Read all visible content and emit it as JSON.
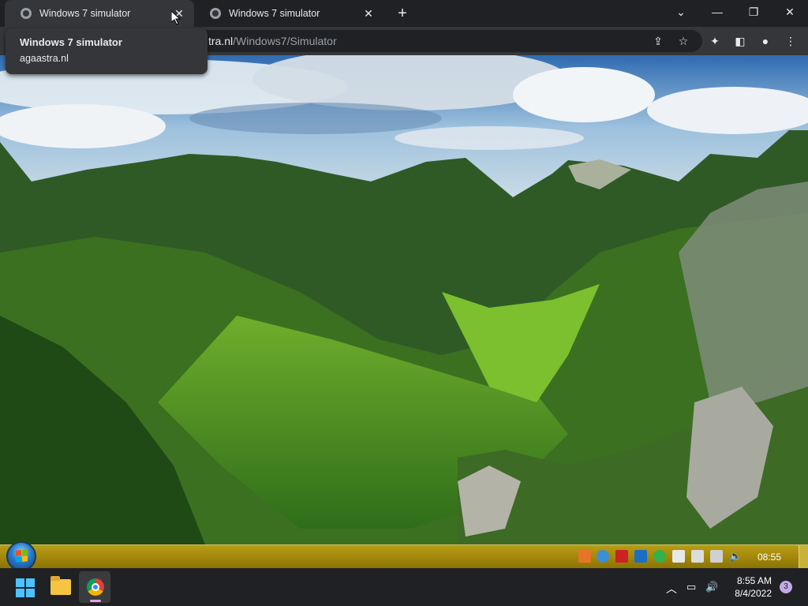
{
  "browser": {
    "tabs": [
      {
        "title": "Windows 7 simulator",
        "active": true
      },
      {
        "title": "Windows 7 simulator",
        "active": false
      }
    ],
    "url": {
      "host_visible": "tra.nl",
      "path": "/Windows7/Simulator"
    },
    "tooltip": {
      "title": "Windows 7 simulator",
      "domain": "agaastra.nl"
    }
  },
  "win7_taskbar": {
    "clock": "08:55",
    "colors": {
      "bar": "#a4890a"
    }
  },
  "win11_taskbar": {
    "time": "8:55 AM",
    "date": "8/4/2022",
    "notification_count": "3"
  }
}
